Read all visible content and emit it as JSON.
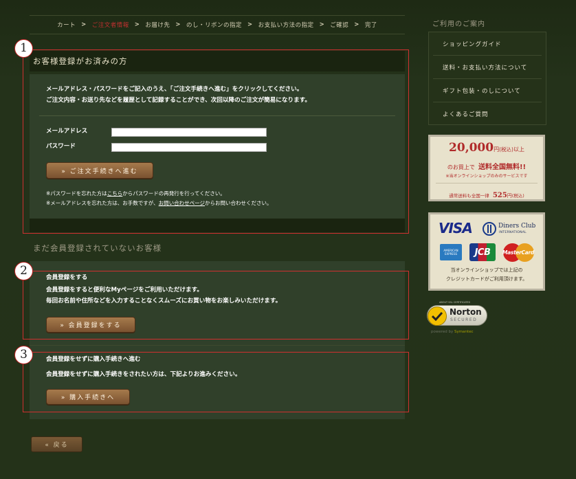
{
  "breadcrumb": {
    "steps": [
      "カート",
      "ご注文者情報",
      "お届け先",
      "のし・リボンの指定",
      "お支払い方法の指定",
      "ご確認",
      "完了"
    ],
    "separator": ">"
  },
  "badges": [
    "1",
    "2",
    "3"
  ],
  "login": {
    "title": "お客様登録がお済みの方",
    "intro1": "メールアドレス・パスワードをご記入のうえ、「ご注文手続きへ進む」をクリックしてください。",
    "intro2": "ご注文内容・お送り先などを履歴として記録することができ、次回以降のご注文が簡易になります。",
    "email_label": "メールアドレス",
    "password_label": "パスワード",
    "email_value": "",
    "password_value": "",
    "submit_label": "» ご注文手続きへ進む",
    "forgot_pw_pre": "※パスワードを忘れた方は",
    "forgot_pw_link": "こちら",
    "forgot_pw_post": "からパスワードの再発行を行ってください。",
    "forgot_mail_pre": "※メールアドレスを忘れた方は、お手数ですが、",
    "forgot_mail_link": "お問い合わせページ",
    "forgot_mail_post": "からお問い合わせください。"
  },
  "guest": {
    "title": "まだ会員登録されていないお客様",
    "register_heading": "会員登録をする",
    "register_text1": "会員登録をすると便利なMyページをご利用いただけます。",
    "register_text2": "毎回お名前や住所などを入力することなくスムーズにお買い物をお楽しみいただけます。",
    "register_button": "» 会員登録をする",
    "noreg_heading": "会員登録をせずに購入手続きへ進む",
    "noreg_text": "会員登録をせずに購入手続きをされたい方は、下記よりお進みください。",
    "noreg_button": "» 購入手続きへ"
  },
  "back_button": "« 戻る",
  "sidebar": {
    "title": "ご利用のご案内",
    "items": [
      "ショッピングガイド",
      "送料・お支払い方法について",
      "ギフト包装・のしについて",
      "よくあるご質問"
    ],
    "shipping": {
      "amount": "20,000",
      "unit": "円",
      "tax": "(税込)",
      "above": "以上",
      "line2_pre": "のお買上で",
      "line2_em": "送料全国無料!!",
      "line3": "※当オンラインショップのみのサービスです",
      "line4_pre": "通常送料も全国一律",
      "line4_amount": "525",
      "line4_unit": "円",
      "line4_tax": "(税込)"
    },
    "cards": {
      "visa": "VISA",
      "diners1": "Diners Club",
      "diners2": "INTERNATIONAL",
      "amex": "AMERICAN EXPRESS",
      "jcb": "JCB",
      "mastercard": "MasterCard",
      "note1": "当オンラインショップでは上記の",
      "note2": "クレジットカードがご利用頂けます。"
    },
    "norton": {
      "top": "ABOUT SSL CERTIFICATES",
      "brand": "Norton",
      "sub": "SECURED",
      "powered_pre": "powered by",
      "powered_by": "Symantec"
    }
  },
  "colors": {
    "accent_red": "#c03030",
    "button_brown": "#8a6038",
    "panel_green": "#30402a"
  }
}
